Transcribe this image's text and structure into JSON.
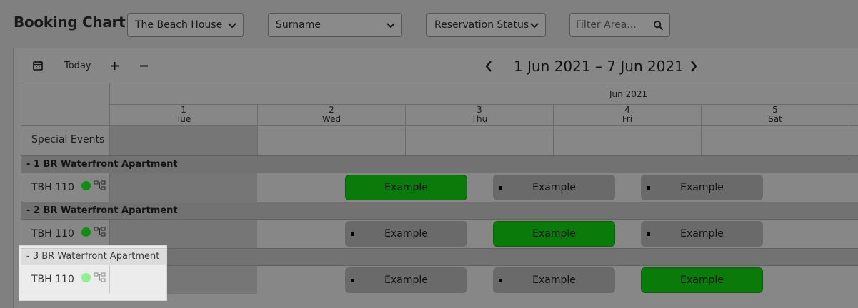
{
  "header": {
    "title": "Booking Chart",
    "property_select": "The Beach House",
    "sort_select": "Surname",
    "status_select": "Reservation Status",
    "filter_placeholder": "Filter Area..."
  },
  "toolbar": {
    "today_label": "Today",
    "plus_icon": "plus-icon",
    "minus_icon": "minus-icon",
    "calendar_icon": "calendar-icon",
    "date_range": "1 Jun 2021 – 7 Jun 2021",
    "prev_icon": "chevron-left-icon",
    "next_icon": "chevron-right-icon"
  },
  "calendar": {
    "month": "Jun 2021",
    "days": [
      {
        "num": "1",
        "name": "Tue"
      },
      {
        "num": "2",
        "name": "Wed"
      },
      {
        "num": "3",
        "name": "Thu"
      },
      {
        "num": "4",
        "name": "Fri"
      },
      {
        "num": "5",
        "name": "Sat"
      }
    ],
    "special_events_label": "Special Events"
  },
  "groups": [
    {
      "label": "- 1 BR Waterfront Apartment",
      "room": "TBH 110",
      "bookings": [
        {
          "label": "Example",
          "style": "green"
        },
        {
          "label": "Example",
          "style": "grey"
        },
        {
          "label": "Example",
          "style": "grey"
        }
      ]
    },
    {
      "label": "- 2 BR Waterfront Apartment",
      "room": "TBH 110",
      "bookings": [
        {
          "label": "Example",
          "style": "grey"
        },
        {
          "label": "Example",
          "style": "green"
        },
        {
          "label": "Example",
          "style": "grey"
        }
      ]
    },
    {
      "label": "- 3 BR Waterfront Apartment",
      "room": "TBH 110",
      "bookings": [
        {
          "label": "Example",
          "style": "grey"
        },
        {
          "label": "Example",
          "style": "grey"
        },
        {
          "label": "Example",
          "style": "green"
        }
      ]
    }
  ],
  "colors": {
    "overlay": "#808080",
    "booking_green": "#0a7a0a",
    "booking_grey": "#6a6a6a",
    "status_dot": "#0f8f0f",
    "status_dot_highlight": "#8ef08e"
  }
}
